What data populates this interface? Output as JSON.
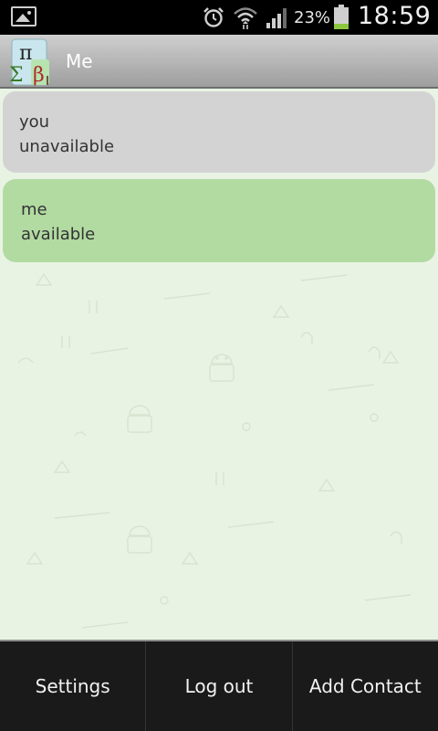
{
  "status_bar": {
    "notification_icon": "picture-icon",
    "alarm_icon": "alarm-clock-icon",
    "wifi_icon": "wifi-icon",
    "signal_icon": "signal-strength-icon",
    "battery_percent": "23%",
    "battery_level": 0.23,
    "time": "18:59"
  },
  "title_bar": {
    "app_icon": "pi-sigma-beta-icon",
    "title": "Me"
  },
  "contacts": [
    {
      "name": "you",
      "status": "unavailable",
      "color": "#d3d3d3"
    },
    {
      "name": "me",
      "status": "available",
      "color": "#b2dba2"
    }
  ],
  "actions": {
    "settings_label": "Settings",
    "logout_label": "Log out",
    "add_contact_label": "Add Contact"
  },
  "colors": {
    "background": "#e9f3e4",
    "available": "#b2dba2",
    "unavailable": "#d3d3d3",
    "battery_fill": "#8cc63f",
    "action_bar": "#1a1a1a"
  }
}
